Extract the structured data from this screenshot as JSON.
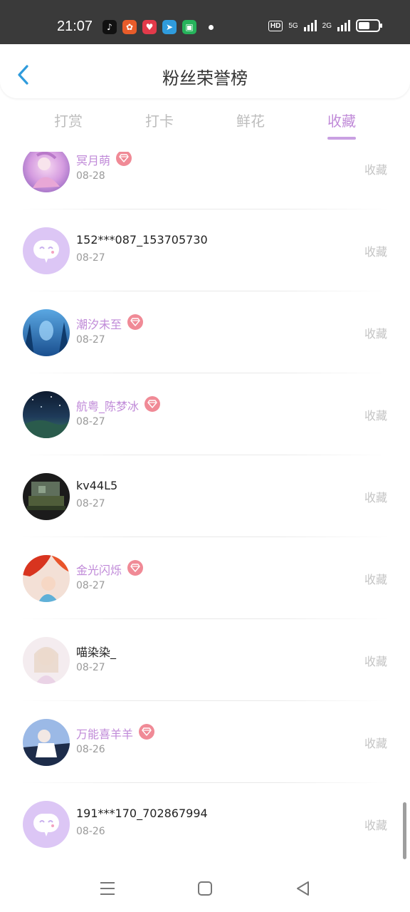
{
  "status_bar": {
    "time": "21:07",
    "hd_label": "HD",
    "net1": "5G",
    "net2": "2G",
    "app_icons": [
      "tiktok-icon",
      "xiaohongshu-icon",
      "heart-app-icon",
      "telegram-icon",
      "android-app-icon"
    ],
    "app_colors": [
      "#111111",
      "#e85c2a",
      "#e23a4a",
      "#2f9bdc",
      "#26b35b"
    ]
  },
  "header": {
    "title": "粉丝荣誉榜"
  },
  "tabs": [
    {
      "label": "打赏"
    },
    {
      "label": "打卡"
    },
    {
      "label": "鲜花"
    },
    {
      "label": "收藏"
    }
  ],
  "active_tab": 3,
  "colors": {
    "accent": "#c08ad8",
    "badge": "#f08a96",
    "back": "#2f9bdc"
  },
  "fans": [
    {
      "name": "冥月萌",
      "date": "08-28",
      "action": "收藏",
      "vip": true,
      "avatar": "anime-pink-avatar"
    },
    {
      "name": "152***087_153705730",
      "date": "08-27",
      "action": "收藏",
      "vip": false,
      "avatar": "default-chat-avatar"
    },
    {
      "name": "潮汐未至",
      "date": "08-27",
      "action": "收藏",
      "vip": true,
      "avatar": "blue-forest-avatar"
    },
    {
      "name": "航粤_陈梦冰",
      "date": "08-27",
      "action": "收藏",
      "vip": true,
      "avatar": "night-sky-avatar"
    },
    {
      "name": "kv44L5",
      "date": "08-27",
      "action": "收藏",
      "vip": false,
      "avatar": "pixel-dark-avatar"
    },
    {
      "name": "金光闪烁",
      "date": "08-27",
      "action": "收藏",
      "vip": true,
      "avatar": "red-leaves-avatar"
    },
    {
      "name": "喵染染_",
      "date": "08-27",
      "action": "收藏",
      "vip": false,
      "avatar": "anime-light-avatar"
    },
    {
      "name": "万能喜羊羊",
      "date": "08-26",
      "action": "收藏",
      "vip": true,
      "avatar": "anime-blue-avatar"
    },
    {
      "name": "191***170_702867994",
      "date": "08-26",
      "action": "收藏",
      "vip": false,
      "avatar": "default-chat-avatar"
    }
  ],
  "nav": [
    "menu-icon",
    "home-icon",
    "back-triangle-icon"
  ]
}
